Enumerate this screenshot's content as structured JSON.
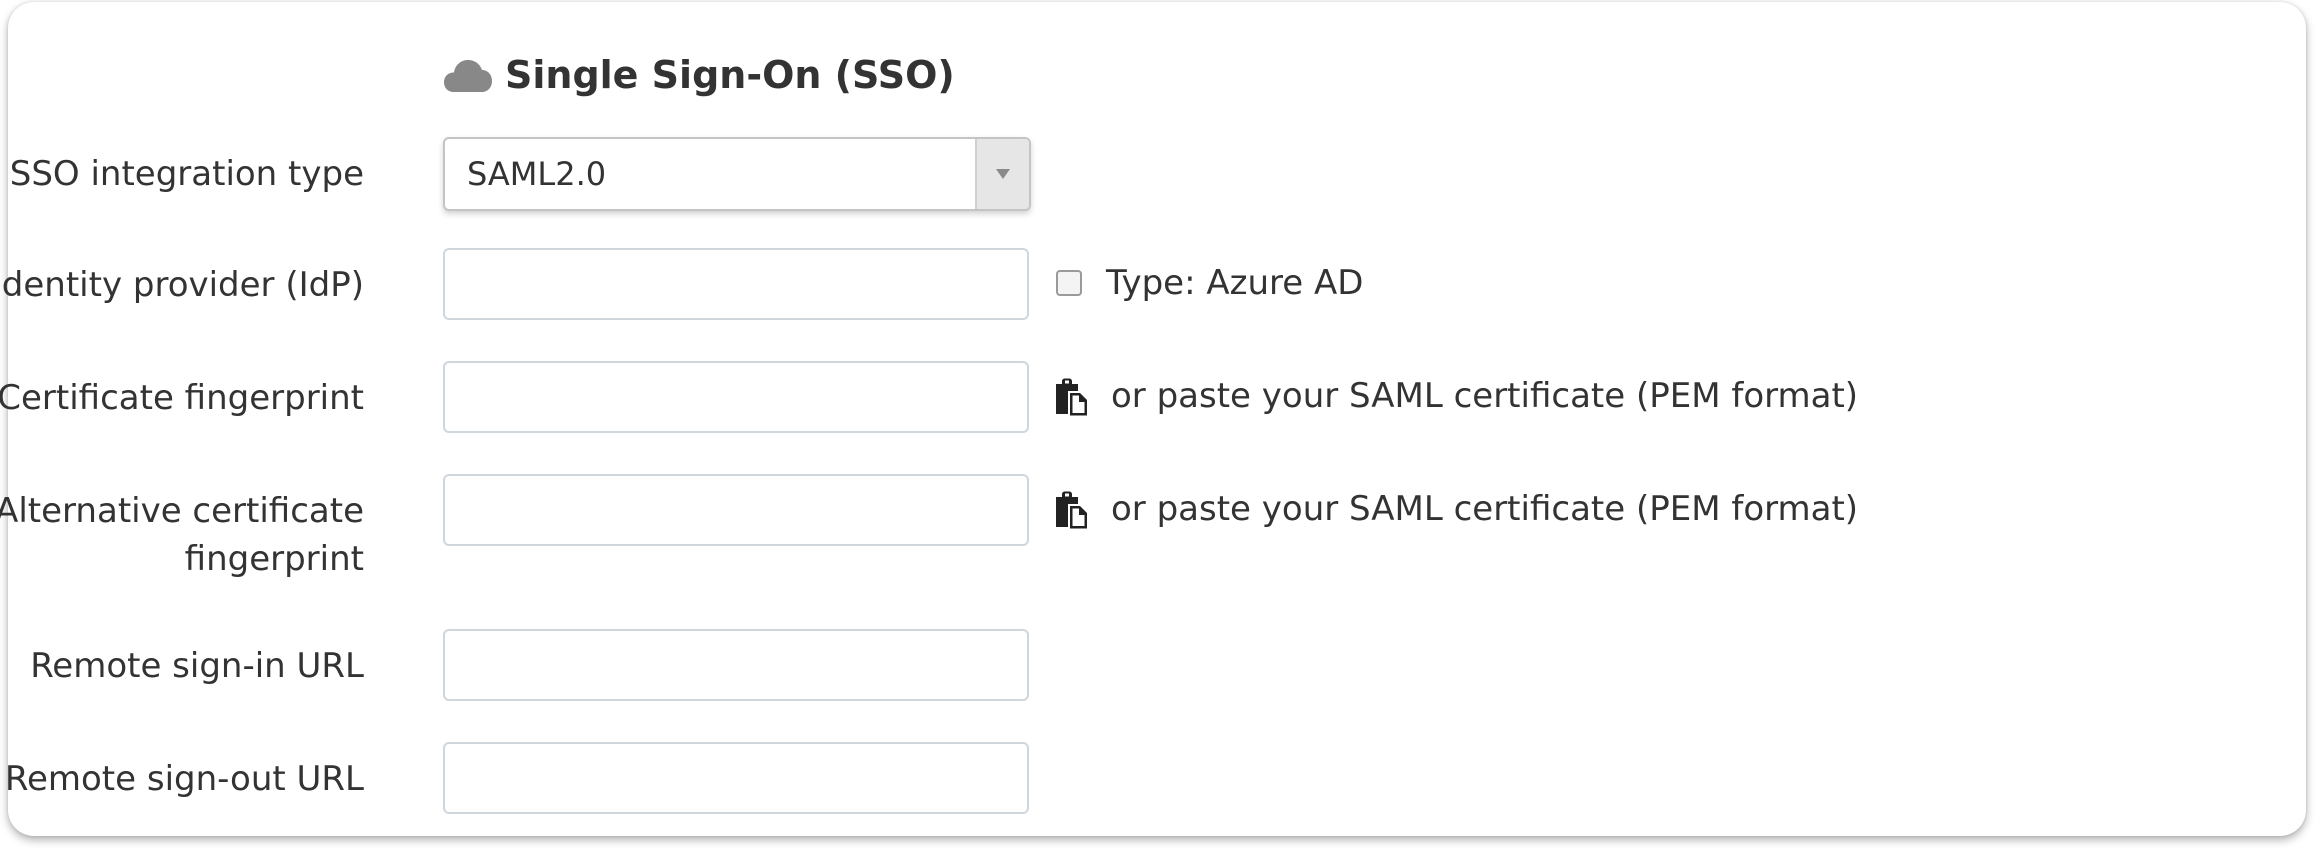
{
  "section": {
    "title": "Single Sign-On (SSO)",
    "icon": "cloud-icon"
  },
  "fields": {
    "sso_type": {
      "label": "SSO integration type",
      "value": "SAML2.0"
    },
    "idp": {
      "label": "Identity provider (IdP)",
      "value": "",
      "checkbox_checked": false,
      "checkbox_label": "Type:  Azure AD"
    },
    "cert_fingerprint": {
      "label": "Certificate fingerprint",
      "value": "",
      "paste_hint": "or paste your SAML certificate (PEM format)",
      "paste_icon": "paste-icon"
    },
    "alt_cert_fingerprint": {
      "label_line1": "Alternative certificate",
      "label_line2": "fingerprint",
      "value": "",
      "paste_hint": "or paste your SAML certificate (PEM format)",
      "paste_icon": "paste-icon"
    },
    "remote_signin": {
      "label": "Remote sign-in URL",
      "value": ""
    },
    "remote_signout": {
      "label": "Remote sign-out URL",
      "value": ""
    }
  },
  "colors": {
    "text": "#333333",
    "icon": "#888888",
    "input_border": "#cfd6dc"
  }
}
